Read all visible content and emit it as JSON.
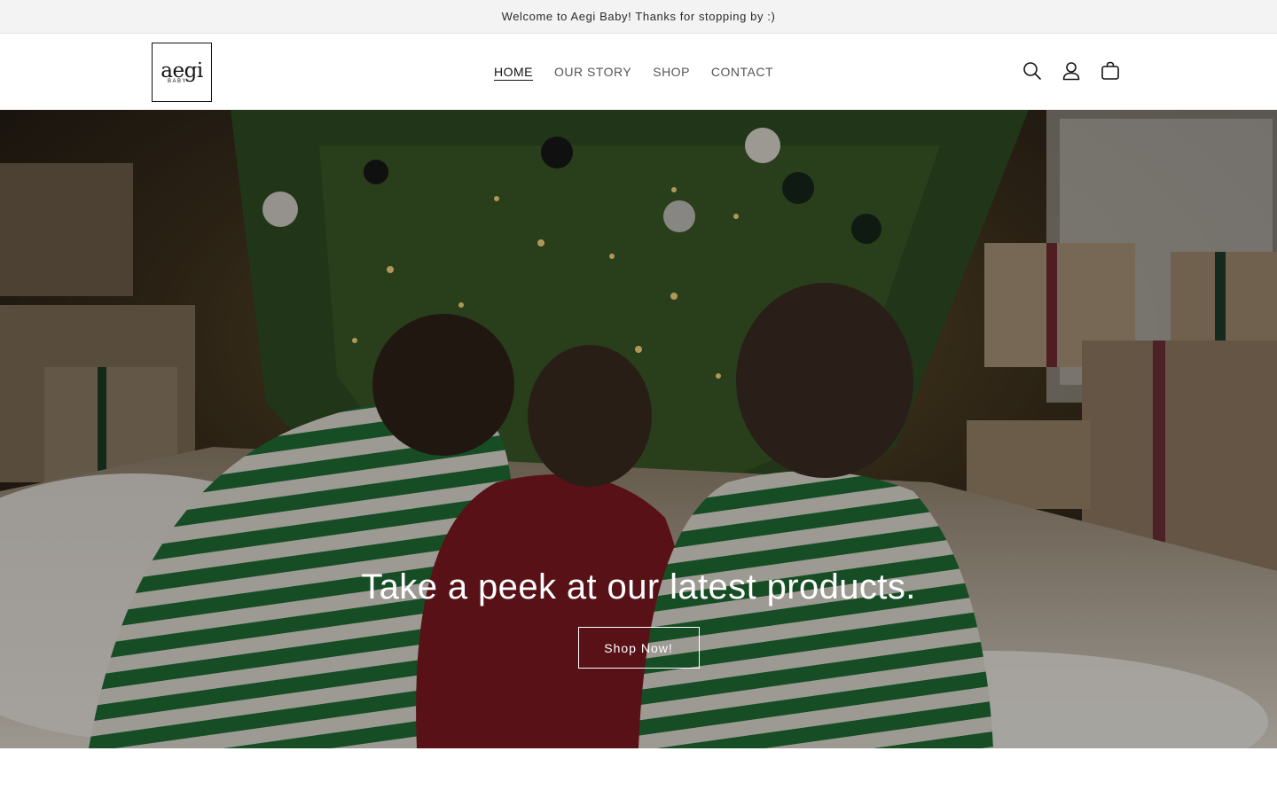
{
  "announcement": {
    "text": "Welcome to Aegi Baby! Thanks for stopping by :)"
  },
  "header": {
    "logo": {
      "word": "aegi",
      "sub": "BABY"
    },
    "nav": [
      {
        "label": "HOME",
        "active": true
      },
      {
        "label": "OUR STORY",
        "active": false
      },
      {
        "label": "SHOP",
        "active": false
      },
      {
        "label": "CONTACT",
        "active": false
      }
    ],
    "icons": [
      "search-icon",
      "account-icon",
      "cart-icon"
    ]
  },
  "hero": {
    "heading": "Take a peek at our latest products.",
    "button_label": "Shop Now!"
  },
  "colors": {
    "announcement_bg": "#f3f3f3",
    "text": "#121212",
    "nav_muted": "#555555",
    "hero_text": "#ffffff"
  }
}
